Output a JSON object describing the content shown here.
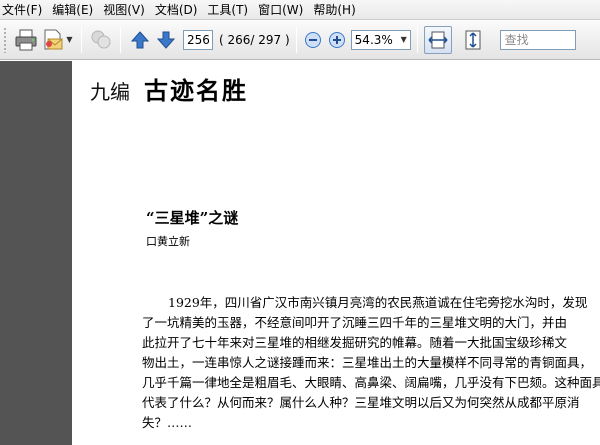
{
  "menu": {
    "items": [
      "文件(F)",
      "编辑(E)",
      "视图(V)",
      "文档(D)",
      "工具(T)",
      "窗口(W)",
      "帮助(H)"
    ]
  },
  "toolbar": {
    "current_page": "256",
    "page_count": "( 266/ 297 )",
    "zoom": "54.3%",
    "search_placeholder": "查找"
  },
  "document": {
    "chapter_label": "九编",
    "chapter_title": "古迹名胜",
    "article_title": "“三星堆”之谜",
    "author": "口黄立新",
    "lines": [
      "1929年，四川省广汉市南兴镇月亮湾的农民燕道诚在住宅旁挖水沟时，发现",
      "了一坑精美的玉器，不经意间叩开了沉睡三四千年的三星堆文明的大门，并由",
      "此拉开了七十年来对三星堆的相继发掘研究的帷幕。随着一大批国宝级珍稀文",
      "物出土，一连串惊人之谜接踵而来：三星堆出土的大量模样不同寻常的青铜面具，",
      "几乎千篇一律地全是粗眉毛、大眼睛、高鼻梁、阔扁嘴，几乎没有下巴颏。这种面具",
      "代表了什么？从何而来？属什么人种？三星堆文明以后又为何突然从成都平原消",
      "失？……"
    ]
  },
  "colors": {
    "left_strip": "#545454",
    "toolbar_blue": "#3b78c9"
  }
}
